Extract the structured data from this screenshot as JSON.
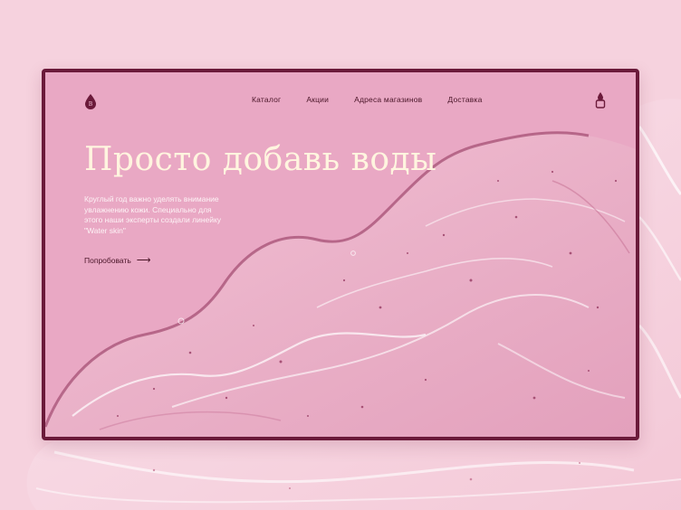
{
  "colors": {
    "background": "#f6d2de",
    "frame_border": "#6b1a3a",
    "hero_background": "#e9a8c4",
    "title": "#fff5df",
    "accent_dark": "#4a1528"
  },
  "header": {
    "logo_icon": "droplet-logo-icon",
    "nav": [
      {
        "label": "Каталог"
      },
      {
        "label": "Акции"
      },
      {
        "label": "Адреса магазинов"
      },
      {
        "label": "Доставка"
      }
    ],
    "cart_icon": "droplet-bag-icon"
  },
  "hero": {
    "title": "Просто добавь воды",
    "text": "Круглый год важно уделять внимание увлажнению кожи. Специально для этого наши эксперты создали линейку \"Water skin\"",
    "cta_label": "Попробовать",
    "cta_icon": "arrow-right-icon"
  }
}
